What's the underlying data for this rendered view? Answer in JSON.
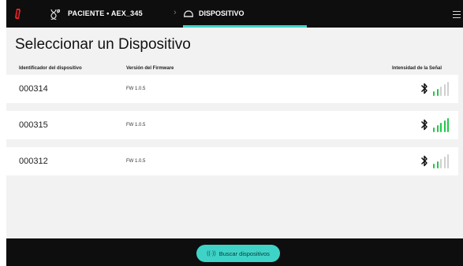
{
  "header": {
    "patient_label": "PACIENTE • AEX_345",
    "device_tab": "DISPOSITIVO"
  },
  "page": {
    "title": "Seleccionar un Dispositivo"
  },
  "columns": {
    "id": "Identificador del dispositivo",
    "firmware": "Versión del Firmware",
    "signal": "Intensidad de la Señal"
  },
  "devices": [
    {
      "id": "000314",
      "firmware": "FW 1.0.5",
      "signal_level": 2
    },
    {
      "id": "000315",
      "firmware": "FW 1.0.5",
      "signal_level": 5
    },
    {
      "id": "000312",
      "firmware": "FW 1.0.5",
      "signal_level": 2
    }
  ],
  "signal_max": 5,
  "footer": {
    "scan_icon": "scan-wave-icon",
    "scan_label": "Buscar dispositivos"
  },
  "colors": {
    "accent": "#3fd3c8",
    "bar_dark": "#0e0e0e",
    "signal_on": "#22c84a",
    "signal_off": "#d0d0d0",
    "logo_red": "#e8232b"
  }
}
